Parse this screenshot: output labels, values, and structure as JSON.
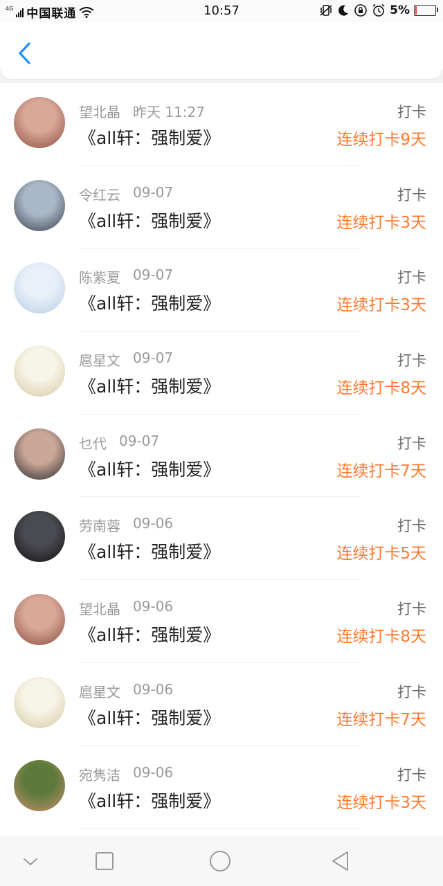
{
  "status_bar": {
    "network": "4G",
    "carrier": "中国联通",
    "time": "10:57",
    "battery_percent": "5%",
    "battery_level": 0.05,
    "icons": [
      "signal-icon",
      "wifi-icon",
      "vibrate-icon",
      "moon-icon",
      "rotation-lock-icon",
      "alarm-icon",
      "battery-icon"
    ]
  },
  "header": {
    "back_icon": "chevron-left-icon"
  },
  "items": [
    {
      "name": "望北晶",
      "time": "昨天 11:27",
      "title": "《all轩：强制爱》",
      "action": "打卡",
      "streak": "连续打卡9天",
      "avatar_colors": [
        "#d9a898",
        "#8c4a3e"
      ]
    },
    {
      "name": "令红云",
      "time": "09-07",
      "title": "《all轩：强制爱》",
      "action": "打卡",
      "streak": "连续打卡3天",
      "avatar_colors": [
        "#a9b8c8",
        "#3b3f4a"
      ]
    },
    {
      "name": "陈紫夏",
      "time": "09-07",
      "title": "《all轩：强制爱》",
      "action": "打卡",
      "streak": "连续打卡3天",
      "avatar_colors": [
        "#e9f0f8",
        "#b5cde6"
      ]
    },
    {
      "name": "扈星文",
      "time": "09-07",
      "title": "《all轩：强制爱》",
      "action": "打卡",
      "streak": "连续打卡8天",
      "avatar_colors": [
        "#f7f4e8",
        "#d6c9a0"
      ]
    },
    {
      "name": "乜代",
      "time": "09-07",
      "title": "《all轩：强制爱》",
      "action": "打卡",
      "streak": "连续打卡7天",
      "avatar_colors": [
        "#caa898",
        "#2a2a2a"
      ]
    },
    {
      "name": "劳南蓉",
      "time": "09-06",
      "title": "《all轩：强制爱》",
      "action": "打卡",
      "streak": "连续打卡5天",
      "avatar_colors": [
        "#4a4a52",
        "#111111"
      ]
    },
    {
      "name": "望北晶",
      "time": "09-06",
      "title": "《all轩：强制爱》",
      "action": "打卡",
      "streak": "连续打卡8天",
      "avatar_colors": [
        "#d9a898",
        "#8c4a3e"
      ]
    },
    {
      "name": "扈星文",
      "time": "09-06",
      "title": "《all轩：强制爱》",
      "action": "打卡",
      "streak": "连续打卡7天",
      "avatar_colors": [
        "#f7f4e8",
        "#d6c9a0"
      ]
    },
    {
      "name": "宛隽洁",
      "time": "09-06",
      "title": "《all轩：强制爱》",
      "action": "打卡",
      "streak": "连续打卡3天",
      "avatar_colors": [
        "#5d7a3a",
        "#c98e6e"
      ]
    }
  ],
  "nav_bar": {
    "icons": [
      "nav-down-icon",
      "nav-square-icon",
      "nav-circle-icon",
      "nav-back-triangle-icon"
    ]
  },
  "colors": {
    "accent_blue": "#1e90ff",
    "streak_orange": "#ff7a2e"
  }
}
